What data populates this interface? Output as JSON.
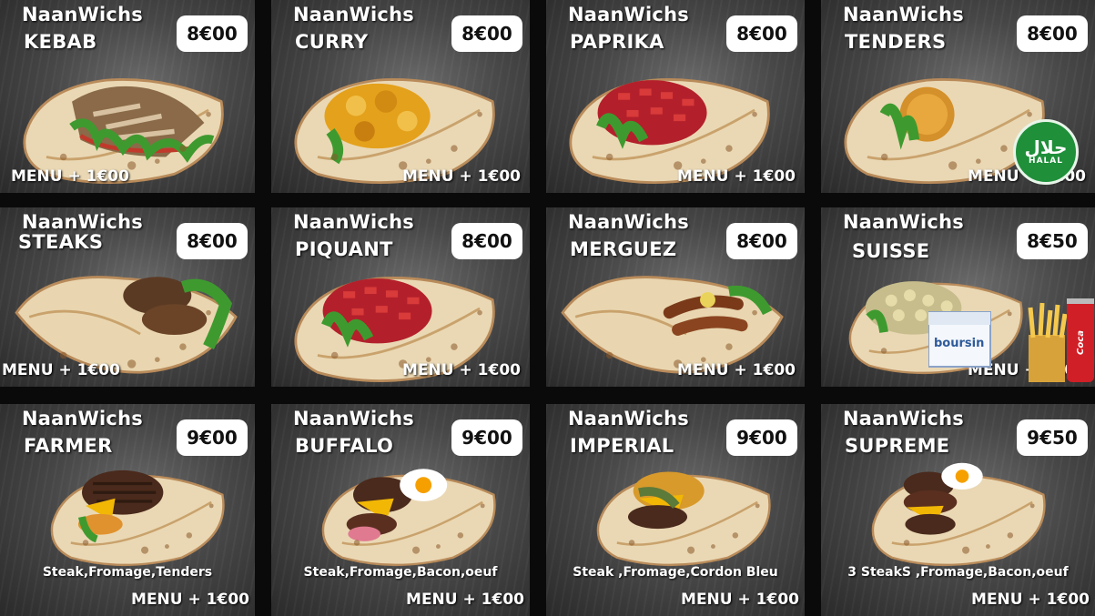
{
  "menu_items": [
    {
      "brand": "NaanWichs",
      "name": "KEBAB",
      "price": "8€00",
      "menu": "MENU + 1€00",
      "filling": "kebab"
    },
    {
      "brand": "NaanWichs",
      "name": "CURRY",
      "price": "8€00",
      "menu": "MENU + 1€00",
      "filling": "curry"
    },
    {
      "brand": "NaanWichs",
      "name": "PAPRIKA",
      "price": "8€00",
      "menu": "MENU + 1€00",
      "filling": "paprika"
    },
    {
      "brand": "NaanWichs",
      "name": "TENDERS",
      "price": "8€00",
      "menu": "MENU + 1€00",
      "filling": "tenders"
    },
    {
      "brand": "NaanWichs",
      "name": "STEAKS",
      "price": "8€00",
      "menu": "MENU + 1€00",
      "filling": "steaks"
    },
    {
      "brand": "NaanWichs",
      "name": "PIQUANT",
      "price": "8€00",
      "menu": "MENU + 1€00",
      "filling": "paprika"
    },
    {
      "brand": "NaanWichs",
      "name": "MERGUEZ",
      "price": "8€00",
      "menu": "MENU + 1€00",
      "filling": "merguez"
    },
    {
      "brand": "NaanWichs",
      "name": "SUISSE",
      "price": "8€50",
      "menu": "MENU + 1€00",
      "filling": "suisse"
    },
    {
      "brand": "NaanWichs",
      "name": "FARMER",
      "price": "9€00",
      "menu": "MENU + 1€00",
      "desc": "Steak,Fromage,Tenders",
      "filling": "farmer"
    },
    {
      "brand": "NaanWichs",
      "name": "BUFFALO",
      "price": "9€00",
      "menu": "MENU + 1€00",
      "desc": "Steak,Fromage,Bacon,oeuf",
      "filling": "buffalo"
    },
    {
      "brand": "NaanWichs",
      "name": "IMPERIAL",
      "price": "9€00",
      "menu": "MENU + 1€00",
      "desc": "Steak ,Fromage,Cordon Bleu",
      "filling": "imperial"
    },
    {
      "brand": "NaanWichs",
      "name": "SUPREME",
      "price": "9€50",
      "menu": "MENU + 1€00",
      "desc": "3 SteakS ,Fromage,Bacon,oeuf",
      "filling": "supreme"
    }
  ],
  "badges": {
    "halal_arabic": "حلال",
    "halal_latin": "HALAL",
    "cheese_brand": "boursin",
    "cola_brand": "Coca"
  },
  "colors": {
    "halal_green": "#1f8f3a",
    "price_bg": "#ffffff",
    "card_bg": "#474747"
  }
}
